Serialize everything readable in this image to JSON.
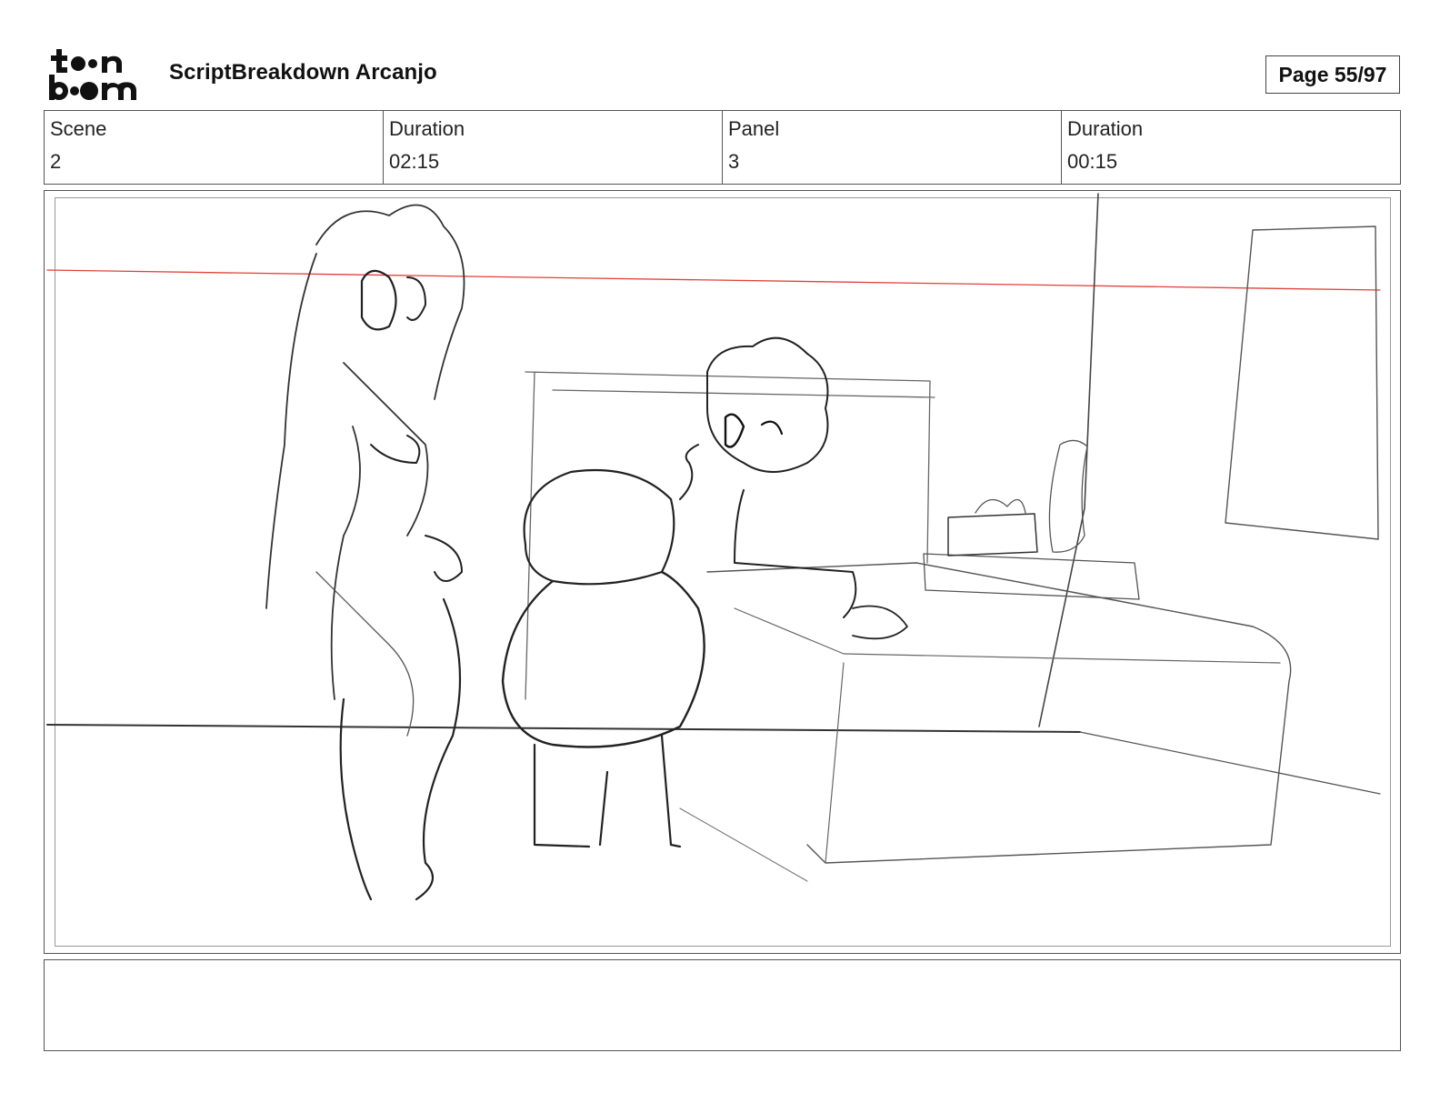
{
  "header": {
    "logo_text_top": "toon",
    "logo_text_bottom": "boom",
    "project_title": "ScriptBreakdown Arcanjo",
    "page_label": "Page 55/97"
  },
  "info": {
    "scene_label": "Scene",
    "scene_value": "2",
    "scene_duration_label": "Duration",
    "scene_duration_value": "02:15",
    "panel_label": "Panel",
    "panel_value": "3",
    "panel_duration_label": "Duration",
    "panel_duration_value": "00:15"
  },
  "panel": {
    "description": ""
  },
  "notes": {
    "text": ""
  }
}
